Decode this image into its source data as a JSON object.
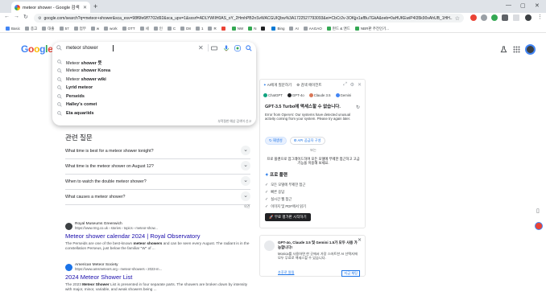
{
  "browser": {
    "tab_title": "meteor shower - Google 검색",
    "url": "google.com/search?q=meteor+shower&sca_esv=98f6fe6ff7702d92&sca_upv=1&sxsrf=ADLYWIIH0AS_oY_2HmhPB2nSvWACGUIQbw%3A1722527793093&ei=CbCr2v-3OKjjx1afBu7GkA&oeb=0aHUKEwiP4I35k90vAhUB_1HH...",
    "bookmarks": [
      {
        "label": "Basic",
        "color": "#4285f4"
      },
      {
        "label": "종고",
        "color": "#9aa0a6"
      },
      {
        "label": "대출",
        "color": "#9aa0a6"
      },
      {
        "label": "57",
        "color": "#9aa0a6"
      },
      {
        "label": "업무",
        "color": "#9aa0a6"
      },
      {
        "label": "w",
        "color": "#9aa0a6"
      },
      {
        "label": "work",
        "color": "#9aa0a6"
      },
      {
        "label": "OTT",
        "color": "#9aa0a6"
      },
      {
        "label": "세",
        "color": "#9aa0a6"
      },
      {
        "label": "인",
        "color": "#9aa0a6"
      },
      {
        "label": "C",
        "color": "#9aa0a6"
      },
      {
        "label": "D8",
        "color": "#9aa0a6"
      },
      {
        "label": "1",
        "color": "#9aa0a6"
      },
      {
        "label": "R",
        "color": "#9aa0a6"
      },
      {
        "label": "",
        "color": "#ea4335"
      },
      {
        "label": "NW",
        "color": "#34a853"
      },
      {
        "label": "N",
        "color": "#34a853"
      },
      {
        "label": "",
        "color": "#202124"
      },
      {
        "label": "Bing",
        "color": "#0078d4"
      },
      {
        "label": "AI",
        "color": "#9aa0a6"
      },
      {
        "label": "AAGAO",
        "color": "#9aa0a6"
      },
      {
        "label": "펀드 & 앤드",
        "color": "#34a853"
      },
      {
        "label": "NBR판 주전인기...",
        "color": "#34a853"
      }
    ]
  },
  "logo": {
    "letters": [
      "G",
      "o",
      "o",
      "g",
      "l",
      "e"
    ],
    "colors": [
      "#4285f4",
      "#ea4335",
      "#fbbc05",
      "#4285f4",
      "#34a853",
      "#ea4335"
    ]
  },
  "search": {
    "query": "meteor shower",
    "suggestions": [
      {
        "base": "Meteor",
        "rest": " shower 뜻"
      },
      {
        "base": "Meteor",
        "rest": " shower Korea"
      },
      {
        "base": "Meteor",
        "rest": " shower wiki"
      },
      {
        "base": "",
        "rest": "Lyrid meteor"
      },
      {
        "base": "",
        "rest": "Perseids"
      },
      {
        "base": "",
        "rest": "Halley's comet"
      },
      {
        "base": "",
        "rest": "Eta aquariids"
      }
    ],
    "report": "부적절한 예상 검색어 신고"
  },
  "paa": {
    "title": "관련 질문",
    "questions": [
      "What time is best for a meteor shower tonight?",
      "What time is the meteor shower on August 12?",
      "When to watch the double meteor shower?",
      "What causes a meteor shower?"
    ],
    "feedback": "의견"
  },
  "results": [
    {
      "site": "Royal Museums Greenwich",
      "crumb": "https://www.rmg.co.uk › stories › topics › meteor-show...",
      "title": "Meteor shower calendar 2024 | Royal Observatory",
      "snippet_pre": "The Perseids are one of the best-known ",
      "snippet_bold": "meteor showers",
      "snippet_post": " and can be seen every August. The radiant is in the constellation Perseus, just below the familiar \"W\" of ...",
      "favicon_color": "#3c4043"
    },
    {
      "site": "American Meteor Society",
      "crumb": "https://www.amsmeteors.org › meteor-showers › 2023-m...",
      "title": "2024 Meteor Shower List",
      "snippet_pre": "The 2023 ",
      "snippet_bold": "Meteor Shower",
      "snippet_post": " List is presented in four separate parts. The showers are broken down by intensity with major, minor, variable, and weak showers being ...",
      "favicon_color": "#1a73e8"
    }
  ],
  "ai_panel": {
    "tabs": [
      "AI에게 질문하기",
      "검색 에이전트"
    ],
    "models": [
      "ChatGPT",
      "GPT-4o",
      "Claude 3.5",
      "Gemini"
    ],
    "heading": "GPT-3.5 Turbo에 액세스할 수 없습니다.",
    "error": "Error from OpenAI: Our systems have detected unusual activity coming from your system. Please try again later.",
    "btn_retry": "재생성",
    "btn_key": "API 공급자 구성",
    "or": "또는",
    "promo": "프로 플랜으로 업그레이드하여 모든 모델에 무제한 접근하고 고급 기능을 이용해 보세요.",
    "pro_title": "프로 플랜",
    "features": [
      "모든 모델에 무제한 접근",
      "빠른 응답",
      "실시간 웹 접근",
      "이미지 및 PDF에서 읽기"
    ],
    "start": "무료 평가판 시작하기"
  },
  "promo_card": {
    "title": "GPT-4o, Claude 3.5 및 Gemini 1.5가 모두 사용 가능합니다!",
    "body": "Monica를 사용하면 한 곳에서 가장 스마트한 AI 선택지에 모두 무료로 액세스할 수 있습니다.",
    "link1": "추후로 알림",
    "link2": "지금 채팅"
  }
}
